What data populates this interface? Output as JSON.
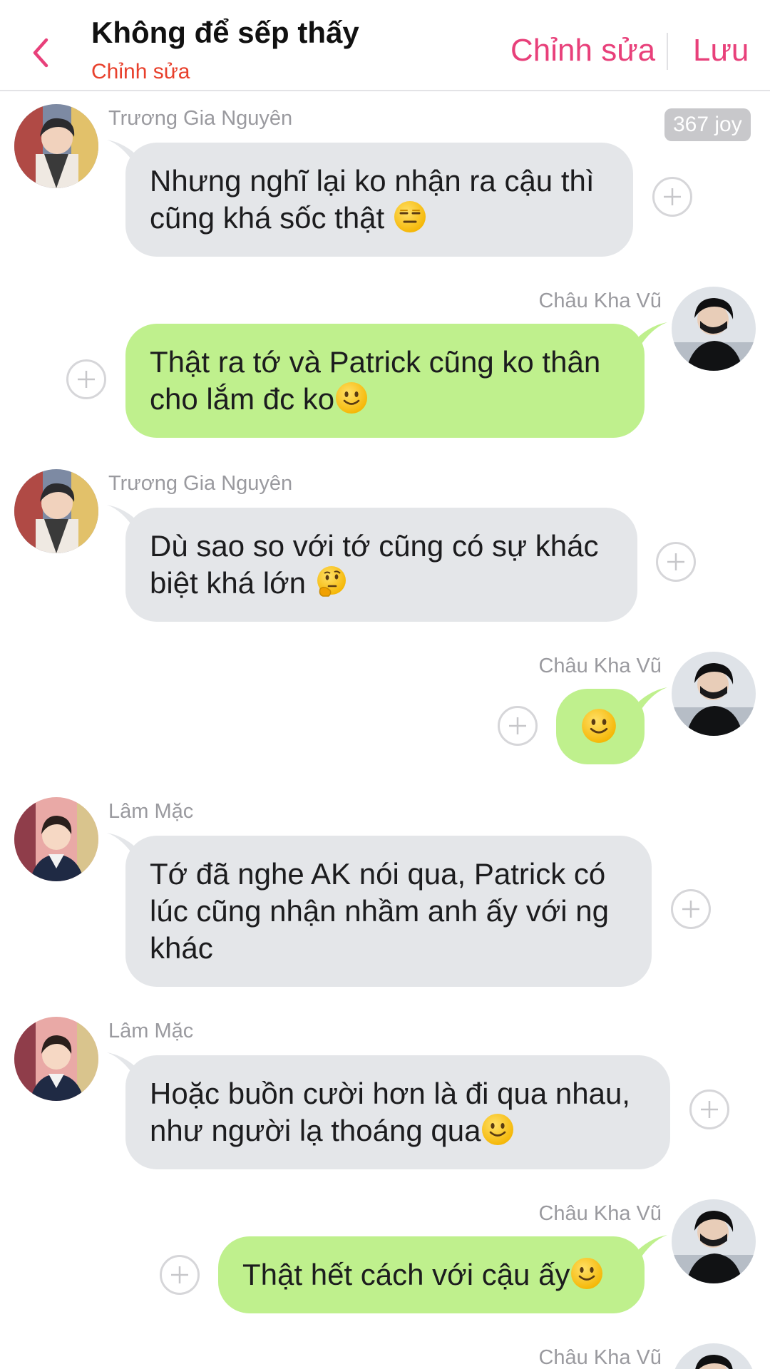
{
  "header": {
    "title": "Không để sếp thấy",
    "subtitle": "Chỉnh sửa",
    "edit_label": "Chỉnh sửa",
    "save_label": "Lưu"
  },
  "joy_badge": "367 joy",
  "colors": {
    "accent": "#e8407a",
    "subtitle": "#e8402c",
    "incoming_bubble": "#e4e6e9",
    "outgoing_bubble": "#bff08d"
  },
  "messages": [
    {
      "sender": "Trương Gia Nguyên",
      "direction": "incoming",
      "text": "Nhưng nghĩ lại ko nhận ra cậu thì cũng khá sốc thật",
      "emoji": "expressionless-face"
    },
    {
      "sender": "Châu Kha Vũ",
      "direction": "outgoing",
      "text": "Thật ra tớ và Patrick cũng ko thân cho lắm đc ko",
      "emoji": "slightly-smiling-face"
    },
    {
      "sender": "Trương Gia Nguyên",
      "direction": "incoming",
      "text": "Dù sao so với tớ cũng có sự khác biệt khá lớn",
      "emoji": "thinking-face"
    },
    {
      "sender": "Châu Kha Vũ",
      "direction": "outgoing",
      "text": "",
      "emoji": "slightly-smiling-face"
    },
    {
      "sender": "Lâm Mặc",
      "direction": "incoming",
      "text": "Tớ đã nghe AK nói qua, Patrick có lúc cũng nhận nhầm anh ấy với ng khác",
      "emoji": ""
    },
    {
      "sender": "Lâm Mặc",
      "direction": "incoming",
      "text": "Hoặc buồn cười hơn là đi qua nhau, như người lạ thoáng qua",
      "emoji": "slightly-smiling-face"
    },
    {
      "sender": "Châu Kha Vũ",
      "direction": "outgoing",
      "text": "Thật hết cách với cậu ấy",
      "emoji": "slightly-smiling-face"
    },
    {
      "sender": "Châu Kha Vũ",
      "direction": "outgoing",
      "text": "",
      "emoji": ""
    }
  ]
}
